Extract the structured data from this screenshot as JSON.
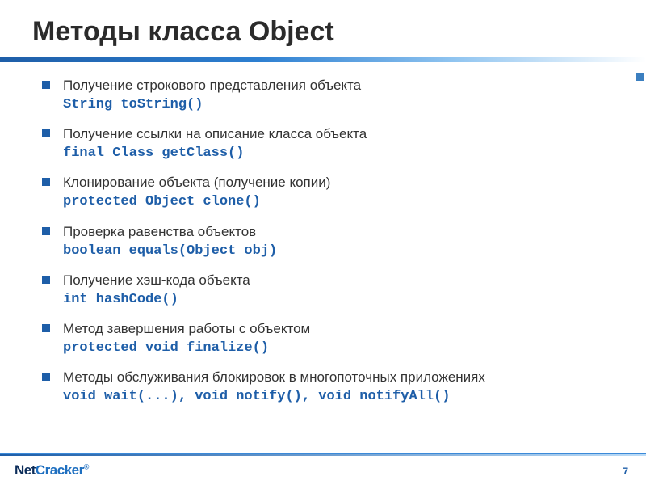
{
  "title": "Методы класса Object",
  "items": [
    {
      "desc": "Получение строкового представления объекта",
      "code": "String toString()"
    },
    {
      "desc": "Получение ссылки на описание класса объекта",
      "code": "final Class getClass()"
    },
    {
      "desc": "Клонирование объекта (получение копии)",
      "code": "protected Object clone()"
    },
    {
      "desc": "Проверка равенства объектов",
      "code": "boolean equals(Object obj)"
    },
    {
      "desc": "Получение хэш-кода объекта",
      "code": "int hashCode()"
    },
    {
      "desc": "Метод завершения работы с объектом",
      "code": "protected void finalize()"
    },
    {
      "desc": "Методы обслуживания блокировок в многопоточных приложениях",
      "code": "void wait(...), void notify(), void notifyAll()"
    }
  ],
  "logo": {
    "part1": "Net",
    "part2": "Cracker",
    "reg": "®"
  },
  "page_number": "7"
}
